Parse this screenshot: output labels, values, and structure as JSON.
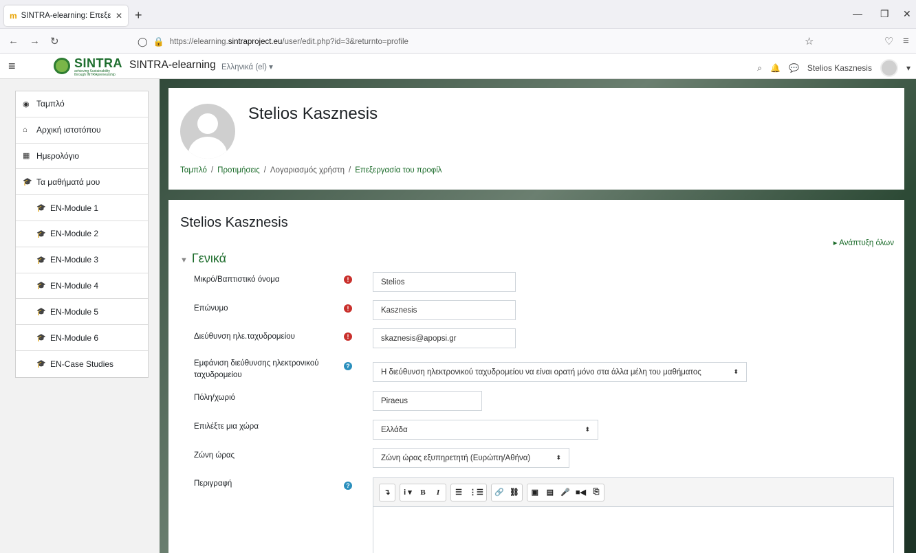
{
  "browser": {
    "tab_title": "SINTRA-elearning: Επεξεργασία",
    "tab_favicon": "m",
    "new_tab": "+",
    "url_prefix": "https://elearning.",
    "url_host": "sintraproject.eu",
    "url_path": "/user/edit.php?id=3&returnto=profile"
  },
  "header": {
    "site_name": "SINTRA-elearning",
    "language": "Ελληνικά (el) ▾",
    "logo_word": "SINTRA",
    "logo_sub1": "achieving Sustainability",
    "logo_sub2": "through INTRApreneurship",
    "user_name": "Stelios Kasznesis"
  },
  "drawer": {
    "items": [
      {
        "label": "Ταμπλό",
        "icon": "dashboard-icon",
        "glyph": "◉",
        "sub": false
      },
      {
        "label": "Αρχική ιστοτόπου",
        "icon": "home-icon",
        "glyph": "⌂",
        "sub": false
      },
      {
        "label": "Ημερολόγιο",
        "icon": "calendar-icon",
        "glyph": "▦",
        "sub": false
      },
      {
        "label": "Τα μαθήματά μου",
        "icon": "graduation-cap-icon",
        "glyph": "🎓",
        "sub": false
      },
      {
        "label": "EN-Module 1",
        "icon": "graduation-cap-icon",
        "glyph": "🎓",
        "sub": true
      },
      {
        "label": "EN-Module 2",
        "icon": "graduation-cap-icon",
        "glyph": "🎓",
        "sub": true
      },
      {
        "label": "EN-Module 3",
        "icon": "graduation-cap-icon",
        "glyph": "🎓",
        "sub": true
      },
      {
        "label": "EN-Module 4",
        "icon": "graduation-cap-icon",
        "glyph": "🎓",
        "sub": true
      },
      {
        "label": "EN-Module 5",
        "icon": "graduation-cap-icon",
        "glyph": "🎓",
        "sub": true
      },
      {
        "label": "EN-Module 6",
        "icon": "graduation-cap-icon",
        "glyph": "🎓",
        "sub": true
      },
      {
        "label": "EN-Case Studies",
        "icon": "graduation-cap-icon",
        "glyph": "🎓",
        "sub": true
      }
    ]
  },
  "profile": {
    "name": "Stelios Kasznesis",
    "breadcrumb": [
      "Ταμπλό",
      "Προτιμήσεις",
      "Λογαριασμός χρήστη",
      "Επεξεργασία του προφίλ"
    ],
    "sep": "/"
  },
  "form": {
    "title": "Stelios Kasznesis",
    "expand_all": "Ανάπτυξη όλων",
    "section": "Γενικά",
    "fields": {
      "firstname": {
        "label": "Μικρό/Βαπτιστικό όνομα",
        "value": "Stelios"
      },
      "lastname": {
        "label": "Επώνυμο",
        "value": "Kasznesis"
      },
      "email": {
        "label": "Διεύθυνση ηλε.ταχυδρομείου",
        "value": "skaznesis@apopsi.gr"
      },
      "maildisplay": {
        "label": "Εμφάνιση διεύθυνσης ηλεκτρονικού ταχυδρομείου",
        "value": "Η διεύθυνση ηλεκτρονικού ταχυδρομείου να είναι ορατή μόνο στα άλλα μέλη του μαθήματος"
      },
      "city": {
        "label": "Πόλη/χωριό",
        "value": "Piraeus"
      },
      "country": {
        "label": "Επιλέξτε μια χώρα",
        "value": "Ελλάδα"
      },
      "timezone": {
        "label": "Ζώνη ώρας",
        "value": "Ζώνη ώρας εξυπηρετητή (Ευρώπη/Αθήνα)"
      },
      "description": {
        "label": "Περιγραφή"
      }
    }
  },
  "colors": {
    "accent": "#1b6b2a",
    "required": "#c9302c",
    "help": "#2a8fbd"
  }
}
